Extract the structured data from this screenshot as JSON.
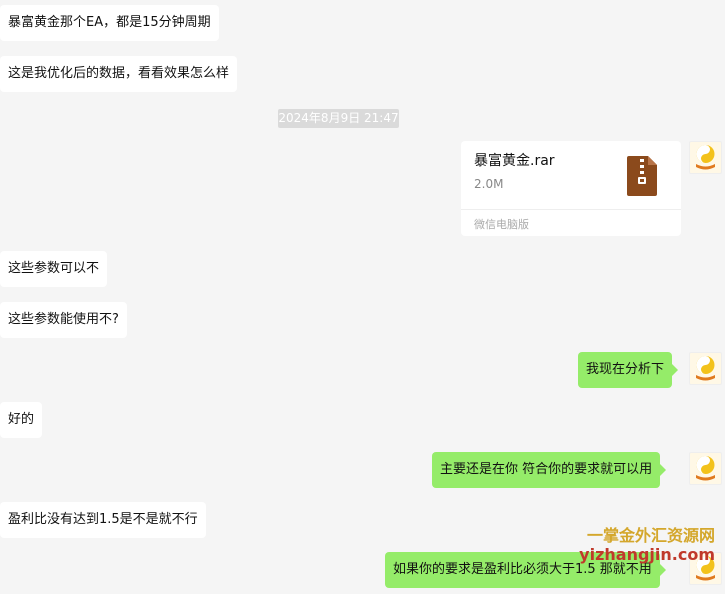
{
  "messages": [
    {
      "text": "暴富黄金那个EA，都是15分钟周期"
    },
    {
      "text": "这是我优化后的数据，看看效果怎么样"
    },
    {
      "text": "这些参数可以不"
    },
    {
      "text": "这些参数能使用不?"
    },
    {
      "text": "我现在分析下"
    },
    {
      "text": "好的"
    },
    {
      "text": "主要还是在你 符合你的要求就可以用"
    },
    {
      "text": "盈利比没有达到1.5是不是就不行"
    },
    {
      "text": "如果你的要求是盈利比必须大于1.5 那就不用"
    }
  ],
  "timestamp": "2024年8月9日 21:47",
  "file": {
    "name": "暴富黄金.rar",
    "size": "2.0M",
    "source": "微信电脑版",
    "icon": "zip-archive-icon"
  },
  "avatar": {
    "icon": "yin-yang-logo-icon",
    "label": "一掌金"
  },
  "watermark": {
    "line1": "一掌金外汇资源网",
    "line2": "yizhangjin.com"
  },
  "colors": {
    "background": "#f5f5f5",
    "left_bubble": "#ffffff",
    "right_bubble": "#95ec69",
    "file_icon": "#8b4a1c",
    "watermark_gold": "#d4a72c",
    "watermark_red": "#c0392b"
  }
}
